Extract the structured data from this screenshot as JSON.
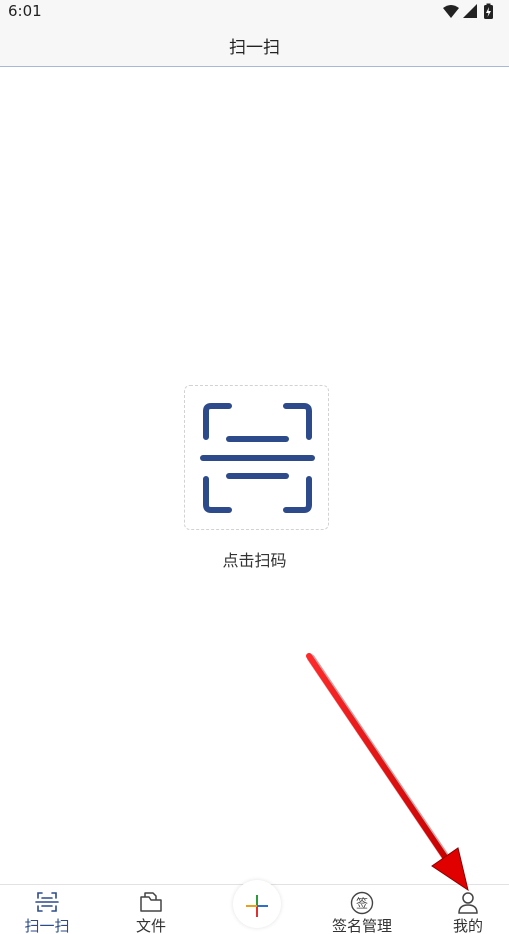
{
  "status_bar": {
    "time": "6:01"
  },
  "header": {
    "title": "扫一扫"
  },
  "scan": {
    "label": "点击扫码",
    "icon": "scan-icon",
    "color": "#2d4a8a"
  },
  "tab_bar": {
    "tabs": [
      {
        "label": "扫一扫",
        "icon": "scan-icon",
        "active": true
      },
      {
        "label": "文件",
        "icon": "folder-icon",
        "active": false
      },
      {
        "label": "签名管理",
        "icon": "signature-icon",
        "active": false
      },
      {
        "label": "我的",
        "icon": "user-icon",
        "active": false
      }
    ],
    "add_button": {
      "icon": "plus-icon"
    }
  },
  "annotation": {
    "color": "#e00000"
  }
}
